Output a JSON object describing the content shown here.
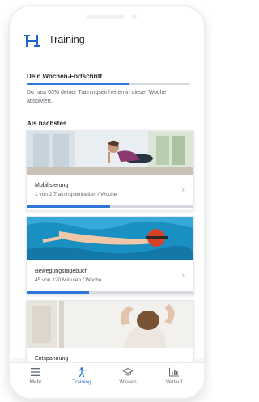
{
  "header": {
    "title": "Training",
    "logo": "hausarzt-logo-icon"
  },
  "progress": {
    "title": "Dein Wochen-Fortschritt",
    "fraction": 0.63,
    "text": "Du hast 63% deiner Trainingseinheiten in dieser Woche absolviert."
  },
  "next": {
    "title": "Als nächstes",
    "cards": [
      {
        "title": "Mobilisierung",
        "subtitle": "1 von 2 Trainingseinheiten / Woche",
        "fraction": 0.5
      },
      {
        "title": "Bewegungstagebuch",
        "subtitle": "45 von 120 Minuten / Woche",
        "fraction": 0.375
      },
      {
        "title": "Entspannung",
        "subtitle": ""
      }
    ]
  },
  "tabs": [
    {
      "label": "Mehr",
      "icon": "menu-icon"
    },
    {
      "label": "Training",
      "icon": "training-figure-icon",
      "active": true
    },
    {
      "label": "Wissen",
      "icon": "graduation-cap-icon"
    },
    {
      "label": "Verlauf",
      "icon": "chart-icon"
    }
  ],
  "colors": {
    "accent": "#2d78d6",
    "logo": "#1a66c9",
    "track": "#d6d9de"
  }
}
